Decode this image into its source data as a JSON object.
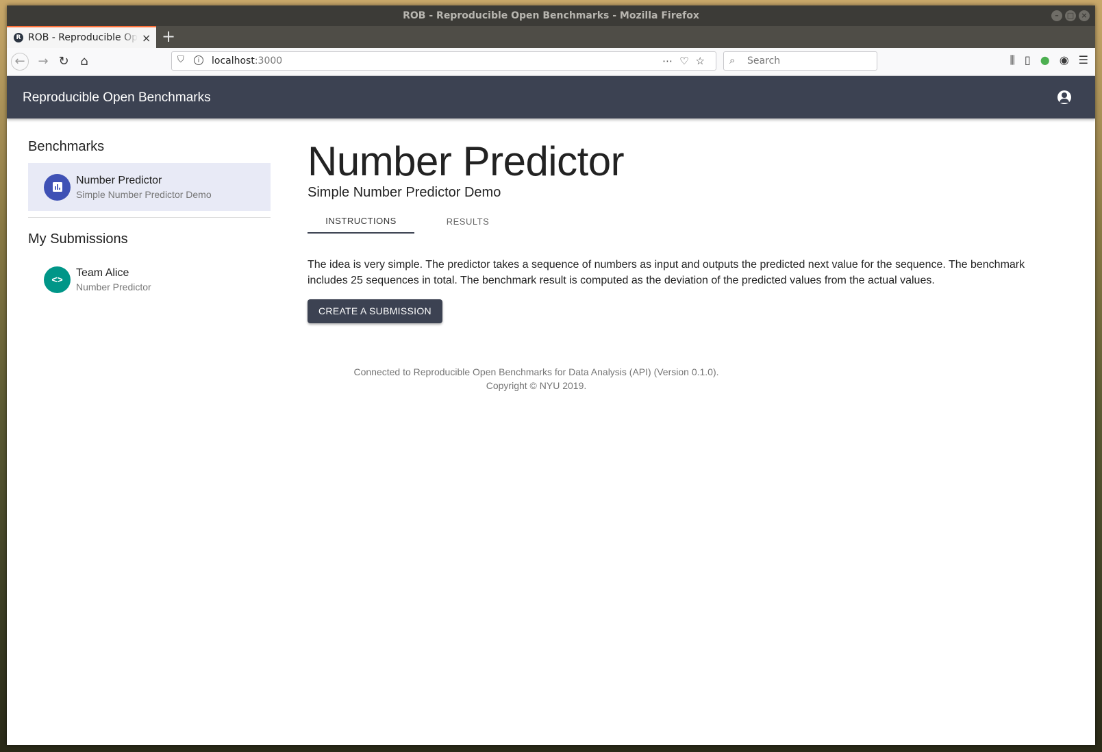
{
  "window": {
    "title": "ROB - Reproducible Open Benchmarks - Mozilla Firefox",
    "minimize": "–",
    "maximize": "□",
    "close": "×"
  },
  "browser": {
    "tab_title": "ROB - Reproducible Open Benchmarks",
    "tab_favicon": "R",
    "tab_close": "×",
    "new_tab": "+",
    "url_host": "localhost",
    "url_port": ":3000",
    "search_placeholder": "Search"
  },
  "app": {
    "title": "Reproducible Open Benchmarks",
    "sidebar": {
      "benchmarks_heading": "Benchmarks",
      "benchmarks": [
        {
          "name": "Number Predictor",
          "description": "Simple Number Predictor Demo",
          "icon": "bar-chart-icon"
        }
      ],
      "submissions_heading": "My Submissions",
      "submissions": [
        {
          "name": "Team Alice",
          "benchmark": "Number Predictor",
          "icon": "code-icon"
        }
      ]
    },
    "main": {
      "title": "Number Predictor",
      "subtitle": "Simple Number Predictor Demo",
      "tabs": [
        {
          "label": "INSTRUCTIONS",
          "active": true
        },
        {
          "label": "RESULTS",
          "active": false
        }
      ],
      "description": "The idea is very simple. The predictor takes a sequence of numbers as input and outputs the predicted next value for the sequence. The benchmark includes 25 sequences in total. The benchmark result is computed as the deviation of the predicted values from the actual values.",
      "cta_label": "CREATE A SUBMISSION"
    },
    "footer": {
      "line1": "Connected to Reproducible Open Benchmarks for Data Analysis (API) (Version 0.1.0).",
      "line2": "Copyright © NYU 2019."
    }
  },
  "colors": {
    "appbar": "#3c4252",
    "benchmark_avatar": "#3f51b5",
    "submission_avatar": "#009688",
    "selected_item": "#e8eaf6"
  }
}
